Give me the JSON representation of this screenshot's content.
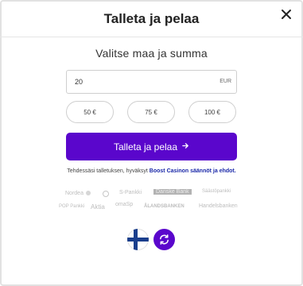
{
  "modal": {
    "title": "Talleta ja pelaa",
    "close_icon": "close-icon"
  },
  "form": {
    "subtitle": "Valitse maa ja summa",
    "amount_value": "20",
    "currency": "EUR",
    "presets": [
      "50 €",
      "75 €",
      "100 €"
    ],
    "submit_label": "Talleta ja pelaa",
    "submit_icon": "arrow-right-icon"
  },
  "terms": {
    "prefix": "Tehdessäsi talletuksen, hyväksyt ",
    "link": "Boost Casinon säännöt ja ehdot."
  },
  "banks": {
    "row1": [
      "Nordea",
      "",
      "S-Pankki",
      "Danske Bank",
      "Säästöpankki"
    ],
    "row2": [
      "POP Pankki",
      "Aktia",
      "omaSp",
      "ÅLANDSBANKEN",
      "Handelsbanken"
    ]
  },
  "footer": {
    "flag_icon": "finland-flag-icon",
    "switch_icon": "refresh-icon"
  },
  "colors": {
    "accent": "#5a06cc",
    "link": "#1a28a8"
  }
}
